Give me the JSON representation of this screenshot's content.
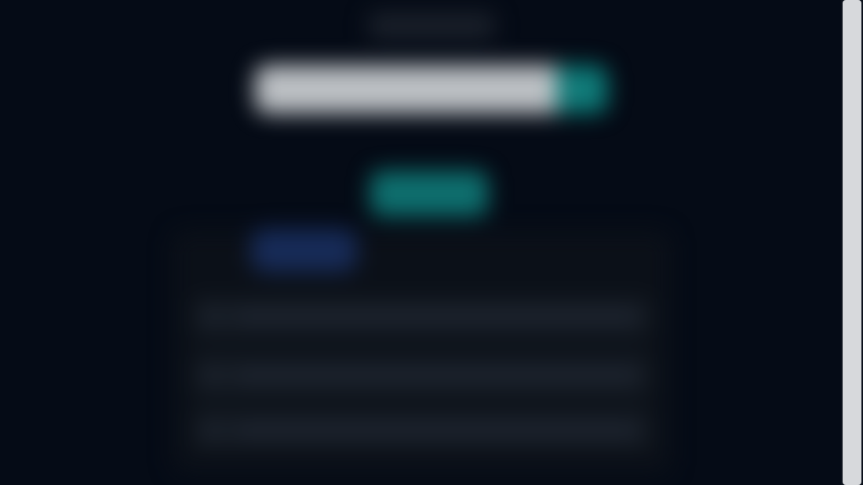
{
  "page": {
    "title": "",
    "search": {
      "placeholder": "",
      "value": "",
      "button_icon": "search-icon"
    },
    "actions": {
      "primary_label": ""
    },
    "filters": {
      "active_label": ""
    },
    "results": [
      {
        "text": ""
      },
      {
        "text": ""
      },
      {
        "text": ""
      }
    ]
  },
  "colors": {
    "background": "#050b16",
    "search_field": "#bcc0c4",
    "accent": "#0b7775",
    "primary_button": "#0e6f6e",
    "filter_chip": "#172b58",
    "panel": "#0b1018",
    "scrollbar": "#d7d9dc"
  }
}
